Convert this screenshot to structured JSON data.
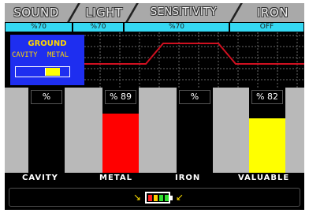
{
  "tabs": {
    "sound": "SOUND",
    "light": "LIGHT",
    "sensitivity": "SENSITIVITY",
    "iron": "IRON"
  },
  "values": {
    "sound": "%70",
    "light": "%70",
    "sensitivity": "%70",
    "iron": "OFF"
  },
  "ground": {
    "title": "GROUND",
    "left_label": "CAVITY",
    "right_label": "METAL",
    "slider_level": 0.5
  },
  "bars": {
    "cavity": {
      "label": "%",
      "level": 0
    },
    "metal": {
      "label": "% 89",
      "level": 0.89
    },
    "iron": {
      "label": "%",
      "level": 0
    },
    "valuable": {
      "label": "% 82",
      "level": 0.82
    }
  },
  "bar_labels": {
    "cavity": "CAVITY",
    "metal": "METAL",
    "iron": "IRON",
    "valuable": "VALUABLE"
  },
  "status": {
    "battery_icon": "battery-icon",
    "charge_icon": "lightning-icon"
  },
  "colors": {
    "tab_value_bg": "#35d8f2",
    "ground_bg": "#1e2ef0",
    "ground_text": "#ffd700",
    "metal_bar": "#ff0000",
    "valuable_bar": "#ffff00",
    "graph_line": "#d01020"
  }
}
